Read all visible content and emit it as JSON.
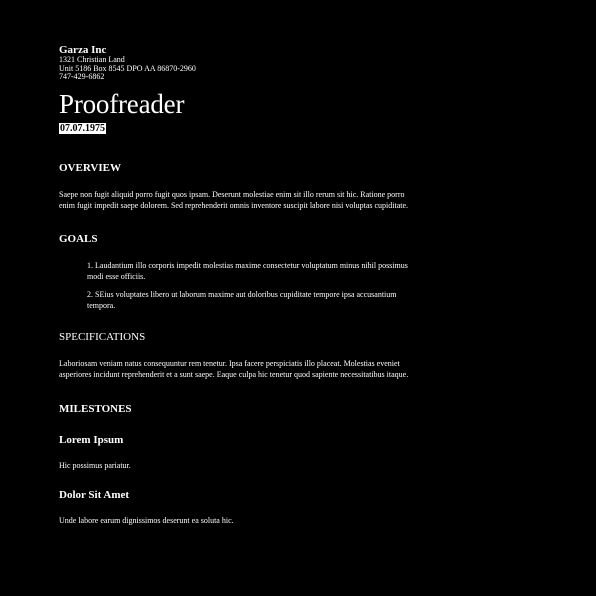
{
  "header": {
    "company": "Garza Inc",
    "address_lines": [
      "1321 Christian Land",
      "Unit 5186 Box 8545 DPO AA 86870-2960",
      "747-429-6862"
    ],
    "title": "Proofreader",
    "date": "07.07.1975"
  },
  "overview": {
    "heading": "OVERVIEW",
    "text": "Saepe non fugit aliquid porro fugit quos ipsam. Deserunt molestiae enim sit illo rerum sit hic. Ratione porro enim fugit impedit saepe dolorem. Sed reprehenderit omnis inventore suscipit labore nisi voluptas cupiditate."
  },
  "goals": {
    "heading": "GOALS",
    "items": [
      "1. Laudantium illo corporis impedit molestias maxime consectetur voluptatum minus nihil possimus modi esse officiis.",
      "2. SEius voluptates libero ut laborum maxime aut doloribus cupiditate tempore ipsa accusantium tempora."
    ]
  },
  "specifications": {
    "heading": "SPECIFICATIONS",
    "text": "Laboriosam veniam natus consequuntur rem tenetur. Ipsa facere perspiciatis illo placeat. Molestias eveniet asperiores incidunt reprehenderit et a sunt saepe. Eaque culpa hic tenetur quod sapiente necessitatibus itaque."
  },
  "milestones": {
    "heading": "MILESTONES",
    "items": [
      {
        "title": "Lorem Ipsum",
        "text": "Hic possimus pariatur."
      },
      {
        "title": "Dolor Sit Amet",
        "text": "Unde labore earum dignissimos deserunt ea soluta hic."
      }
    ]
  }
}
